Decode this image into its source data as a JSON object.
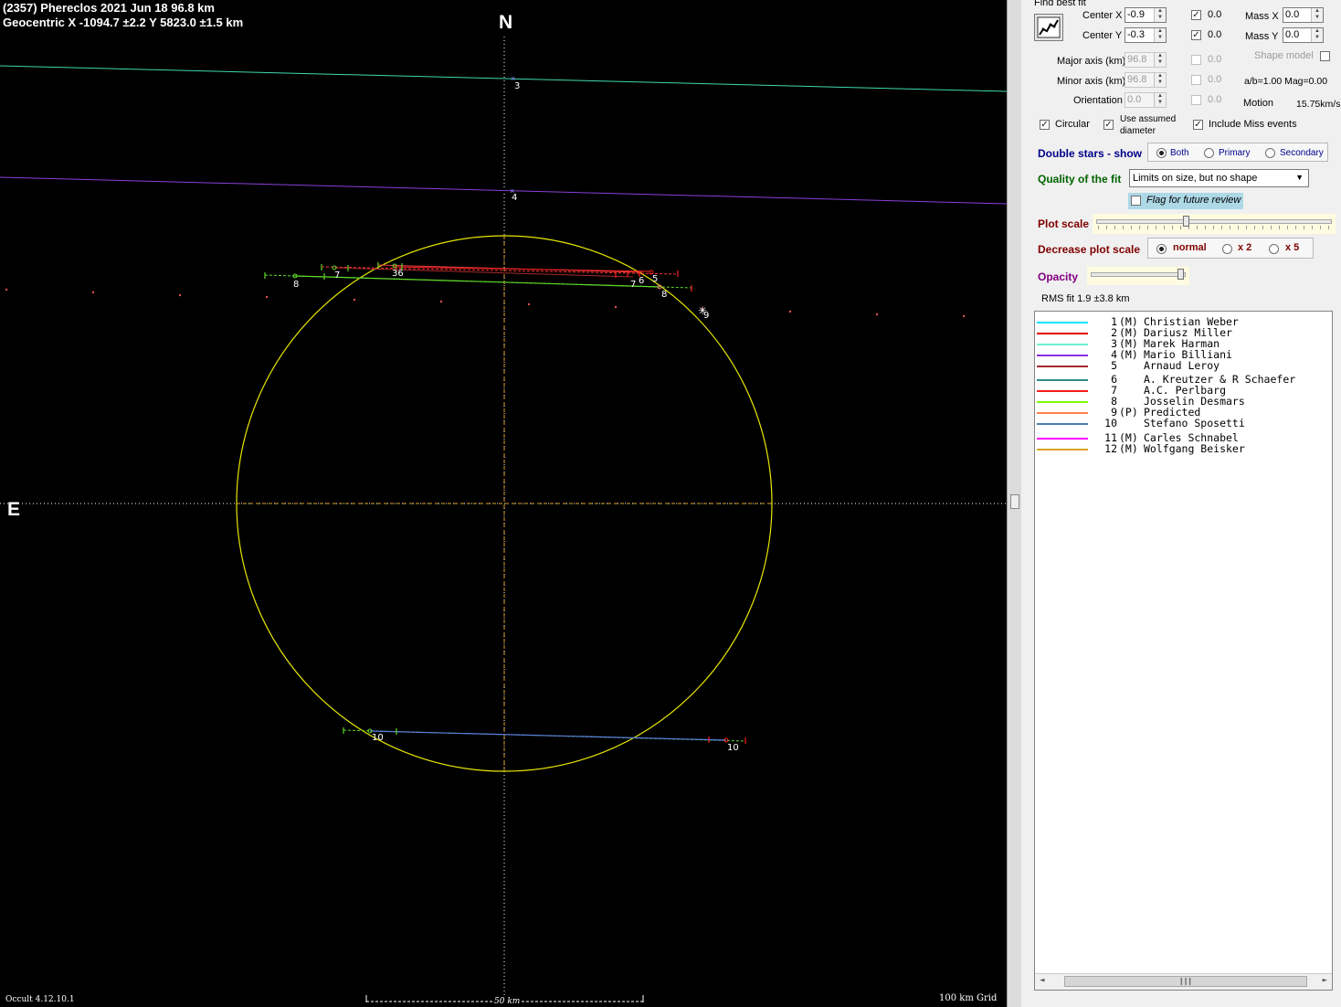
{
  "plot": {
    "title": "(2357) Phereclos  2021 Jun 18   96.8 km",
    "geocentric": "Geocentric  X  -1094.7 ±2.2  Y 5823.0 ±1.5 km",
    "north_label": "N",
    "east_label": "E",
    "version": "Occult 4.12.10.1",
    "scale_label": "50 km",
    "grid_label": "100 km Grid",
    "chord_labels": [
      "3",
      "4",
      "8",
      "7",
      "36",
      "5",
      "6",
      "7",
      "8",
      "9",
      "10",
      "10"
    ],
    "colors": {
      "ellipse": "#e6e600",
      "chord3": "#3fd9b0",
      "chord4": "#8a3fd9",
      "chord8": "#5fd92a",
      "chord10": "#5a7fe0",
      "grid": "#ffffff",
      "axis": "#e0a030"
    }
  },
  "panel": {
    "find_best_fit": "Find best fit",
    "center_x": {
      "label": "Center X",
      "value": "-0.9",
      "checked": true,
      "check_value": "0.0"
    },
    "center_y": {
      "label": "Center Y",
      "value": "-0.3",
      "checked": true,
      "check_value": "0.0"
    },
    "mass_x": {
      "label": "Mass X",
      "value": "0.0"
    },
    "mass_y": {
      "label": "Mass Y",
      "value": "0.0"
    },
    "shape_model": "Shape model",
    "major_axis": {
      "label": "Major axis (km)",
      "value": "96.8",
      "check_value": "0.0"
    },
    "minor_axis": {
      "label": "Minor axis (km)",
      "value": "96.8",
      "check_value": "0.0"
    },
    "orientation": {
      "label": "Orientation",
      "value": "0.0",
      "check_value": "0.0"
    },
    "ab_ratio": "a/b=1.00  Mag=0.00",
    "motion_label": "Motion",
    "motion_value": "15.75km/s",
    "circular": "Circular",
    "use_assumed_1": "Use assumed",
    "use_assumed_2": "diameter",
    "include_miss": "Include Miss events",
    "double_stars": "Double stars - show",
    "ds_both": "Both",
    "ds_primary": "Primary",
    "ds_secondary": "Secondary",
    "quality_label": "Quality of the fit",
    "quality_value": "Limits on size, but no shape",
    "flag_review": "Flag for future review",
    "plot_scale": "Plot scale",
    "decrease_scale": "Decrease plot scale",
    "ds_normal": "normal",
    "ds_x2": "x 2",
    "ds_x5": "x 5",
    "opacity": "Opacity",
    "rms_fit": "RMS fit  1.9 ±3.8 km",
    "plot_scale_level": 0.38,
    "opacity_level": 0.98,
    "colors": {
      "dark_blue": "#00008b",
      "green": "#006400",
      "maroon": "#800000",
      "purple": "#800080",
      "flag_bg": "#add8e6",
      "slider_bg": "#fffbe0"
    }
  },
  "legend": [
    {
      "num": "1",
      "type": "(M)",
      "name": "Christian Weber",
      "color": "#00e5ff"
    },
    {
      "num": "2",
      "type": "(M)",
      "name": "Dariusz Miller",
      "color": "#e00000"
    },
    {
      "num": "3",
      "type": "(M)",
      "name": "Marek Harman",
      "color": "#6ef0d0"
    },
    {
      "num": "4",
      "type": "(M)",
      "name": "Mario Billiani",
      "color": "#8a2be2"
    },
    {
      "num": "5",
      "type": "",
      "name": "Arnaud Leroy",
      "color": "#a52a2a"
    },
    {
      "num": "6",
      "type": "",
      "name": "A. Kreutzer & R Schaefer",
      "color": "#2e8b8b"
    },
    {
      "num": "7",
      "type": "",
      "name": "A.C. Perlbarg",
      "color": "#ff1a1a"
    },
    {
      "num": "8",
      "type": "",
      "name": "Josselin Desmars",
      "color": "#7cfc00"
    },
    {
      "num": "9",
      "type": "(P)",
      "name": "Predicted",
      "color": "#ff7f50"
    },
    {
      "num": "10",
      "type": "",
      "name": "Stefano Sposetti",
      "color": "#4682b4"
    },
    {
      "num": "11",
      "type": "(M)",
      "name": "Carles Schnabel",
      "color": "#ff00ff"
    },
    {
      "num": "12",
      "type": "(M)",
      "name": "Wolfgang Beisker",
      "color": "#daa520"
    }
  ]
}
